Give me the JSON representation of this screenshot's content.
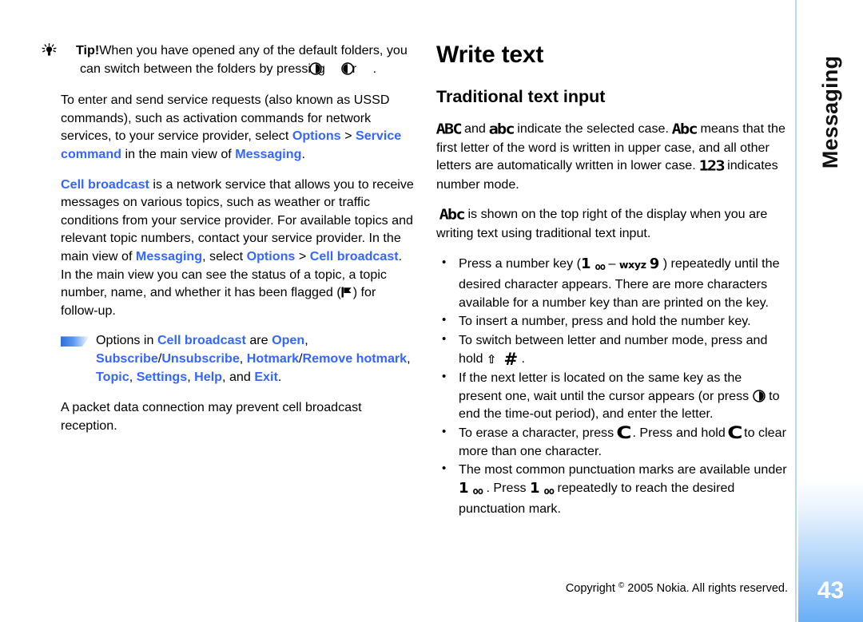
{
  "document": {
    "side_tab_label": "Messaging",
    "page_number": "43",
    "footer": {
      "copyright_pre": "Copyright ",
      "copyright_symbol": "©",
      "copyright_post": " 2005 Nokia. All rights reserved."
    },
    "colors": {
      "link": "#3366ff",
      "tab_gradient_end": "#69aef5",
      "rule": "#b9d9f2"
    }
  },
  "left_column": {
    "tip": {
      "icon": "lightbulb-icon",
      "label": "Tip!",
      "text_a": "When you have opened any of the default folders, you can switch between the folders by pressing ",
      "icon_scroll_right": "nav-right-icon",
      "text_b": " or ",
      "icon_scroll_left": "nav-left-icon",
      "text_c": "."
    },
    "para_ussd": {
      "t1": "To enter and send service requests (also known as USSD commands), such as activation commands for network services, to your service provider, select ",
      "link1": "Options",
      "t2": " > ",
      "link2": "Service command",
      "t3": " in the main view of ",
      "link3": "Messaging",
      "t4": "."
    },
    "para_cellbroadcast": {
      "link1": "Cell broadcast",
      "t1": " is a network service that allows you to receive messages on various topics, such as weather or traffic conditions from your service provider. For available topics and relevant topic numbers, contact your service provider. In the main view of ",
      "link2": "Messaging",
      "t2": ", select ",
      "link3": "Options",
      "t3": " > ",
      "link4": "Cell broadcast",
      "t4": ". In the main view you can see the status of a topic, a topic number, name, and whether it has been flagged (",
      "icon_flag": "flag-icon",
      "t5": ") for follow-up."
    },
    "note_options": {
      "marker": "wedge-marker-icon",
      "t1": "Options in ",
      "link1": "Cell broadcast",
      "t2": " are ",
      "link2": "Open",
      "t3": ", ",
      "link3": "Subscribe",
      "t4": "/",
      "link4": "Unsubscribe",
      "t5": ", ",
      "link5": "Hotmark",
      "t6": "/",
      "link6": "Remove hotmark",
      "t7": ", ",
      "link7": "Topic",
      "t8": ", ",
      "link8": "Settings",
      "t9": ", ",
      "link9": "Help",
      "t10": ", and ",
      "link10": "Exit",
      "t11": "."
    },
    "para_packet": "A packet data connection may prevent cell broadcast reception."
  },
  "right_column": {
    "heading": "Write text",
    "subheading": "Traditional text input",
    "para_case": {
      "indicator_abc_upper": "ABC",
      "t1": " and ",
      "indicator_abc_lower": "abc",
      "t2": " indicate the selected case. ",
      "indicator_abc_mixed": "Abc",
      "t3": " means that the first letter of the word is written in upper case, and all other letters are automatically written in lower case. ",
      "indicator_123": "123",
      "t4": " indicates number mode."
    },
    "para_abc_display": {
      "indicator_abc_mixed": "Abc",
      "t1": " is shown on the top right of the display when you are writing text using traditional text input."
    },
    "bullets": [
      {
        "id": "press-number-key",
        "t1": "Press a number key (",
        "key1_num": "1",
        "key1_sub": "oo",
        "t2": " – ",
        "key2_letters": "wxyz",
        "key2_num": "9",
        "t3": " ) repeatedly until the desired character appears. There are more characters available for a number key than are printed on the key."
      },
      {
        "id": "insert-number",
        "t1": "To insert a number, press and hold the number key."
      },
      {
        "id": "switch-letter-number-mode",
        "t1": "To switch between letter and number mode, press and hold ",
        "key_shift": "⇧",
        "key_hash": "#",
        "t2": " ."
      },
      {
        "id": "next-letter-same-key",
        "t1": "If the next letter is located on the same key as the present one, wait until the cursor appears (or press ",
        "icon_nav": "nav-right-icon",
        "t2": " to end the time-out period), and enter the letter."
      },
      {
        "id": "erase-character",
        "t1": "To erase a character, press ",
        "key_clear_1": "C",
        "t2": " . Press and hold ",
        "key_clear_2": "C",
        "t3": " to clear more than one character."
      },
      {
        "id": "punctuation-marks",
        "t1": "The most common punctuation marks are available under ",
        "key1_num": "1",
        "key1_sub": "oo",
        "t2": " . Press ",
        "key2_num": "1",
        "key2_sub": "oo",
        "t3": " repeatedly to reach the desired punctuation mark."
      }
    ]
  }
}
